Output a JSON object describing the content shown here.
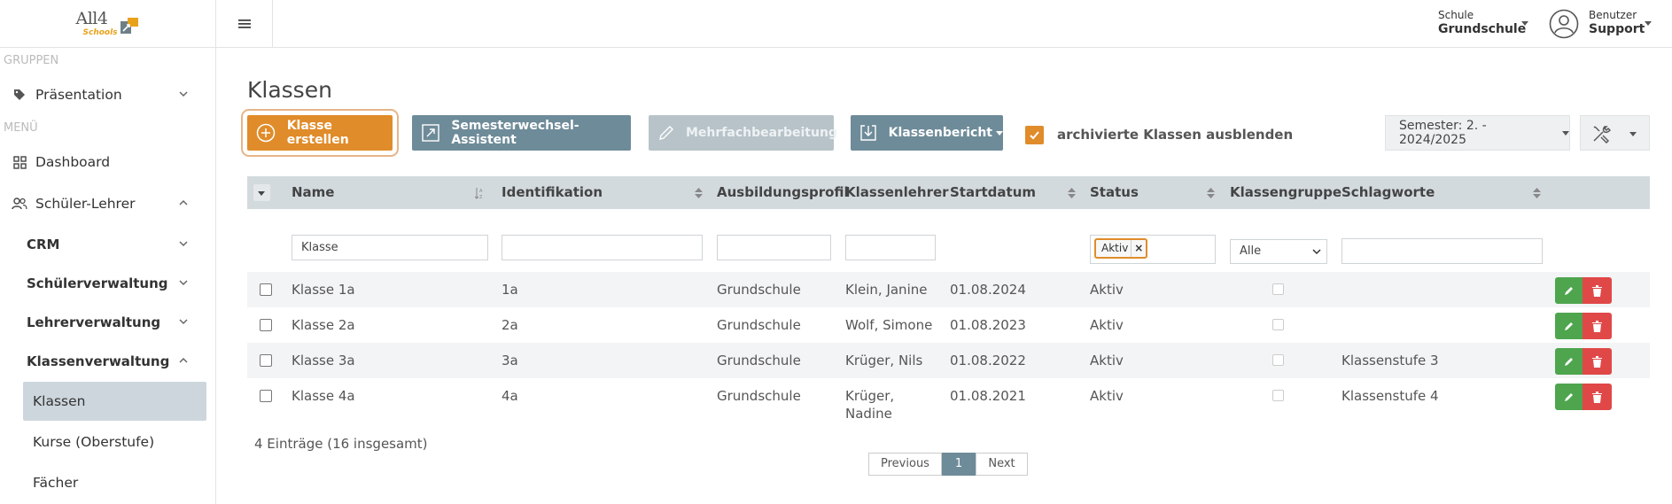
{
  "brand": {
    "name": "All4",
    "sub": "Schools"
  },
  "sidebar": {
    "sections": {
      "gruppen": "GRUPPEN",
      "menu": "MENÜ"
    },
    "items": [
      {
        "label": "Präsentation"
      },
      {
        "label": "Dashboard"
      },
      {
        "label": "Schüler-Lehrer"
      },
      {
        "label": "CRM"
      },
      {
        "label": "Schülerverwaltung"
      },
      {
        "label": "Lehrerverwaltung"
      },
      {
        "label": "Klassenverwaltung"
      },
      {
        "label": "Klassen"
      },
      {
        "label": "Kurse (Oberstufe)"
      },
      {
        "label": "Fächer"
      }
    ]
  },
  "topbar": {
    "school_label": "Schule",
    "school_value": "Grundschule",
    "user_label": "Benutzer",
    "user_value": "Support"
  },
  "page": {
    "title": "Klassen",
    "buttons": {
      "create": "Klasse erstellen",
      "semester_wizard": "Semesterwechsel-Assistent",
      "bulk_edit": "Mehrfachbearbeitung",
      "report": "Klassenbericht"
    },
    "hide_archived_label": "archivierte Klassen ausblenden",
    "hide_archived_checked": true,
    "semester": "Semester: 2. - 2024/2025"
  },
  "table": {
    "headers": [
      "Name",
      "Identifikation",
      "Ausbildungsprofil",
      "Klassenlehrer",
      "Startdatum",
      "Status",
      "Klassengruppe",
      "Schlagworte"
    ],
    "filters": {
      "name": "Klasse",
      "status_tag": "Aktiv",
      "status_tag_remove": "×",
      "group_select": "Alle"
    },
    "rows": [
      {
        "name": "Klasse 1a",
        "id": "1a",
        "profile": "Grundschule",
        "teacher": "Klein, Janine",
        "teacher2": "",
        "start": "01.08.2024",
        "status": "Aktiv",
        "tags": ""
      },
      {
        "name": "Klasse 2a",
        "id": "2a",
        "profile": "Grundschule",
        "teacher": "Wolf, Simone",
        "teacher2": "",
        "start": "01.08.2023",
        "status": "Aktiv",
        "tags": ""
      },
      {
        "name": "Klasse 3a",
        "id": "3a",
        "profile": "Grundschule",
        "teacher": "Krüger, Nils",
        "teacher2": "",
        "start": "01.08.2022",
        "status": "Aktiv",
        "tags": "Klassenstufe 3"
      },
      {
        "name": "Klasse 4a",
        "id": "4a",
        "profile": "Grundschule",
        "teacher": "Krüger,",
        "teacher2": "Nadine",
        "start": "01.08.2021",
        "status": "Aktiv",
        "tags": "Klassenstufe 4"
      }
    ],
    "info": "4 Einträge (16 insgesamt)"
  },
  "pagination": {
    "previous": "Previous",
    "current": "1",
    "next": "Next"
  },
  "colors": {
    "accent": "#e08c2a",
    "grey_button": "#6e8b99",
    "edit": "#4ea54e",
    "delete": "#e04848"
  }
}
